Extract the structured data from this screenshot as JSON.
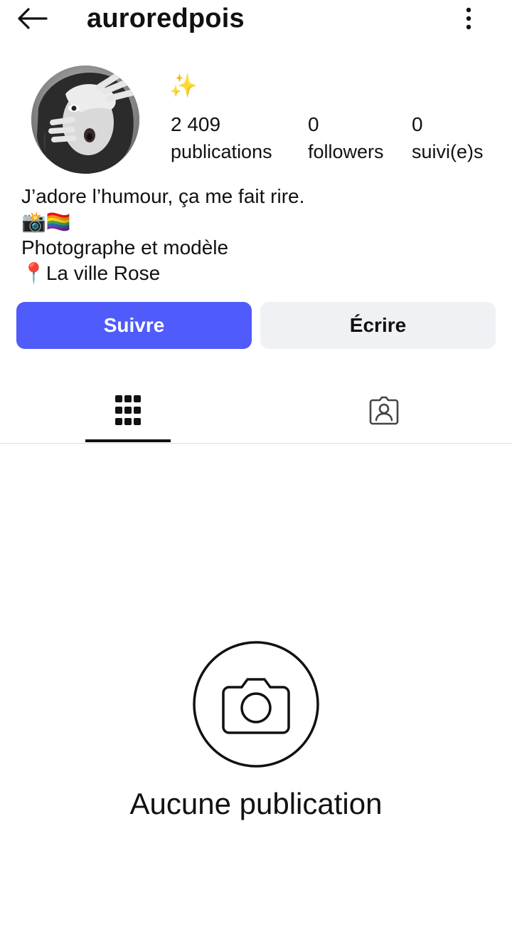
{
  "header": {
    "username": "auroredpois",
    "back_icon": "arrow-left-icon",
    "more_icon": "more-vertical-icon"
  },
  "profile": {
    "emoji": "✨",
    "stats": [
      {
        "value": "2 409",
        "label": "publications"
      },
      {
        "value": "0",
        "label": "followers"
      },
      {
        "value": "0",
        "label": "suivi(e)s"
      }
    ],
    "bio": [
      "J’adore l’humour, ça me fait rire.",
      "📸🏳️‍🌈",
      "Photographe et modèle",
      "📍La ville Rose"
    ]
  },
  "actions": {
    "follow_label": "Suivre",
    "message_label": "Écrire"
  },
  "tabs": {
    "grid_icon": "grid-icon",
    "tagged_icon": "tagged-person-icon"
  },
  "empty_state": {
    "icon": "camera-icon",
    "text": "Aucune publication"
  },
  "colors": {
    "accent": "#4f5bfa",
    "secondary_button": "#f0f1f5",
    "text": "#111111"
  }
}
